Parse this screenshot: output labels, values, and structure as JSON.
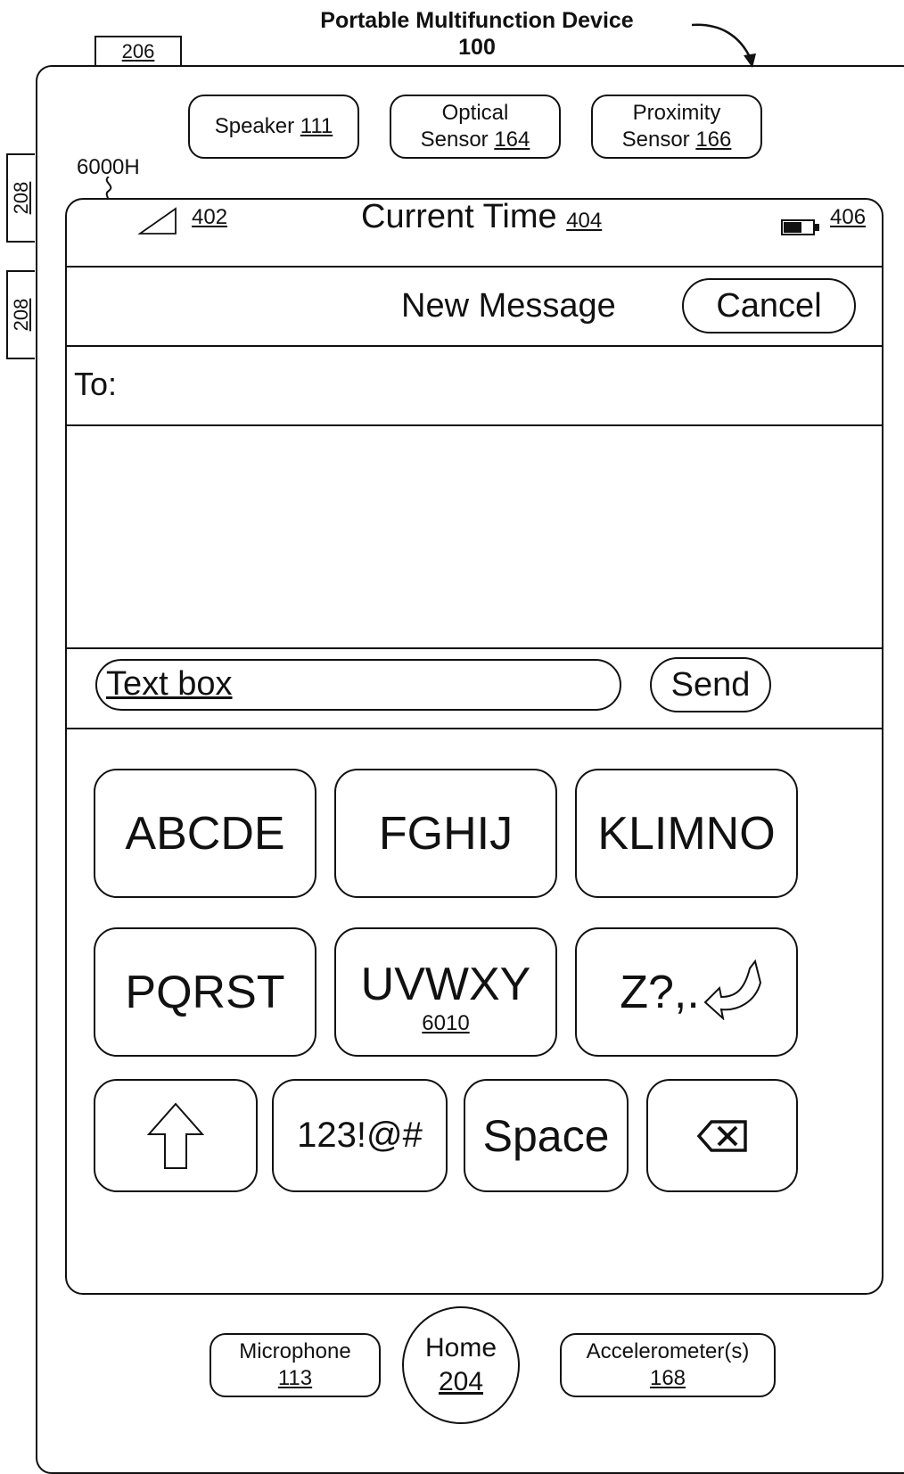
{
  "header": {
    "device_title": "Portable Multifunction Device",
    "device_ref": "100"
  },
  "labels": {
    "tab_206": "206",
    "side_208_a": "208",
    "side_208_b": "208",
    "screen_ref": "6000H"
  },
  "sensors": {
    "speaker": {
      "label": "Speaker",
      "ref": "111"
    },
    "optical": {
      "line1": "Optical",
      "line2": "Sensor",
      "ref": "164"
    },
    "proximity": {
      "line1": "Proximity",
      "line2": "Sensor",
      "ref": "166"
    }
  },
  "status_bar": {
    "signal_ref": "402",
    "time": "Current Time",
    "time_ref": "404",
    "battery_ref": "406"
  },
  "nav": {
    "title": "New Message",
    "cancel": "Cancel"
  },
  "to_field": {
    "label": "To:"
  },
  "composer": {
    "text_box": "Text box",
    "send": "Send"
  },
  "keyboard": {
    "row1": [
      "ABCDE",
      "FGHIJ",
      "KLIMNO"
    ],
    "row2": [
      "PQRST",
      "UVWXY",
      "Z?,."
    ],
    "uvwxy_ref": "6010",
    "numbers": "123!@#",
    "space": "Space"
  },
  "bottom": {
    "microphone": {
      "label": "Microphone",
      "ref": "113"
    },
    "home": {
      "label": "Home",
      "ref": "204"
    },
    "accelerometer": {
      "label": "Accelerometer(s)",
      "ref": "168"
    }
  }
}
